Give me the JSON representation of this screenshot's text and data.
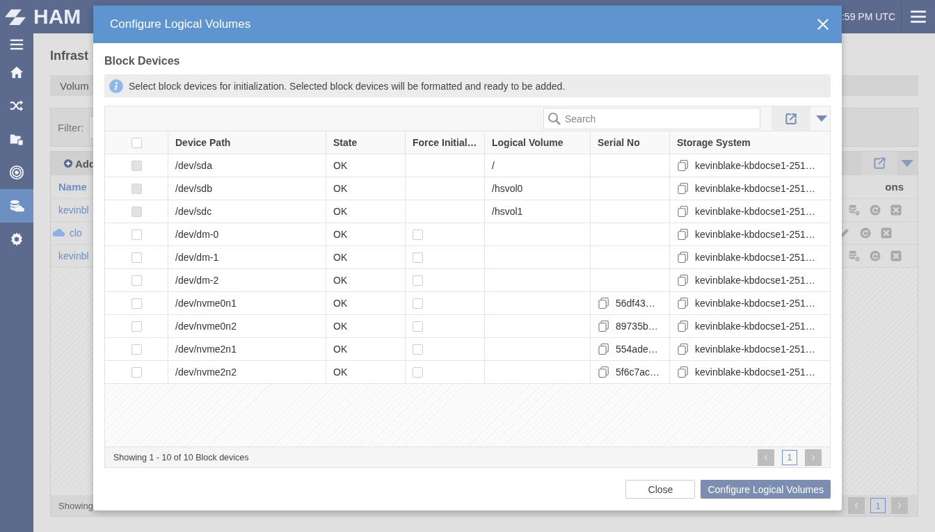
{
  "app": {
    "logo": "HAM",
    "clock": ":59 PM UTC",
    "nav": [
      {
        "selected": false
      },
      {
        "selected": false
      },
      {
        "selected": false
      },
      {
        "selected": false
      },
      {
        "selected": false
      },
      {
        "selected": true
      },
      {
        "selected": false
      }
    ],
    "page": {
      "title": "Infrast",
      "tab": "Volum",
      "filter_label": "Filter:",
      "add_button": "Add",
      "columns": [
        "Name",
        "ons"
      ],
      "rows": [
        {
          "kind": "volume",
          "name": "kevinbl"
        },
        {
          "kind": "cloud",
          "name": "clo"
        },
        {
          "kind": "volume",
          "name": "kevinbl"
        }
      ],
      "footer": "Showing",
      "pages": [
        {
          "label": "1",
          "selected": true
        }
      ]
    }
  },
  "dialog": {
    "title": "Configure Logical Volumes",
    "section": "Block Devices",
    "info": "Select block devices for initialization. Selected block devices will be formatted and ready to be added.",
    "search": {
      "placeholder": "Search"
    },
    "columns": [
      "Device Path",
      "State",
      "Force Initial…",
      "Logical Volume",
      "Serial No",
      "Storage System"
    ],
    "select_all": {
      "checked": false
    },
    "rows": [
      {
        "checked": false,
        "disabled": true,
        "path": "/dev/sda",
        "state": "OK",
        "logical_volume": "/",
        "storage": "kevinblake-kbdocse1-251…"
      },
      {
        "checked": false,
        "disabled": true,
        "path": "/dev/sdb",
        "state": "OK",
        "logical_volume": "/hsvol0",
        "storage": "kevinblake-kbdocse1-251…"
      },
      {
        "checked": false,
        "disabled": true,
        "path": "/dev/sdc",
        "state": "OK",
        "logical_volume": "/hsvol1",
        "storage": "kevinblake-kbdocse1-251…"
      },
      {
        "checked": false,
        "disabled": false,
        "path": "/dev/dm-0",
        "state": "OK",
        "force_initialize": {
          "checked": false
        },
        "storage": "kevinblake-kbdocse1-251…"
      },
      {
        "checked": false,
        "disabled": false,
        "path": "/dev/dm-1",
        "state": "OK",
        "force_initialize": {
          "checked": false
        },
        "storage": "kevinblake-kbdocse1-251…"
      },
      {
        "checked": false,
        "disabled": false,
        "path": "/dev/dm-2",
        "state": "OK",
        "force_initialize": {
          "checked": false
        },
        "storage": "kevinblake-kbdocse1-251…"
      },
      {
        "checked": false,
        "disabled": false,
        "path": "/dev/nvme0n1",
        "state": "OK",
        "force_initialize": {
          "checked": false
        },
        "serial": "56df43…",
        "storage": "kevinblake-kbdocse1-251…"
      },
      {
        "checked": false,
        "disabled": false,
        "path": "/dev/nvme0n2",
        "state": "OK",
        "force_initialize": {
          "checked": false
        },
        "serial": "89735b…",
        "storage": "kevinblake-kbdocse1-251…"
      },
      {
        "checked": false,
        "disabled": false,
        "path": "/dev/nvme2n1",
        "state": "OK",
        "force_initialize": {
          "checked": false
        },
        "serial": "554ade…",
        "storage": "kevinblake-kbdocse1-251…"
      },
      {
        "checked": false,
        "disabled": false,
        "path": "/dev/nvme2n2",
        "state": "OK",
        "force_initialize": {
          "checked": false
        },
        "serial": "5f6c7ac…",
        "storage": "kevinblake-kbdocse1-251…"
      }
    ],
    "footer": "Showing 1 - 10 of 10 Block devices",
    "pages": [
      {
        "label": "1",
        "selected": true
      }
    ],
    "buttons": [
      {
        "kind": "secondary",
        "label": "Close"
      },
      {
        "kind": "primary",
        "label": "Configure Logical Volumes"
      }
    ]
  }
}
